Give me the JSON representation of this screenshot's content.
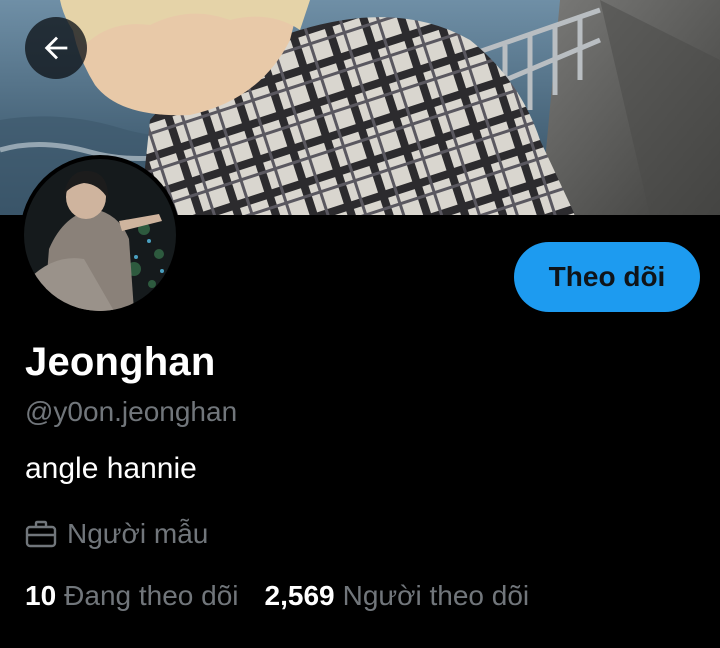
{
  "profile": {
    "display_name": "Jeonghan",
    "handle": "@y0on.jeonghan",
    "bio": "angle hannie",
    "category": "Người mẫu",
    "category_icon": "briefcase-icon"
  },
  "actions": {
    "follow_label": "Theo dõi",
    "back_icon": "arrow-left-icon"
  },
  "stats": {
    "following_count": "10",
    "following_label": "Đang theo dõi",
    "followers_count": "2,569",
    "followers_label": "Người theo dõi"
  },
  "colors": {
    "background": "#000000",
    "accent": "#1d9bf0",
    "primary_text": "#ffffff",
    "secondary_text": "#71767b"
  }
}
